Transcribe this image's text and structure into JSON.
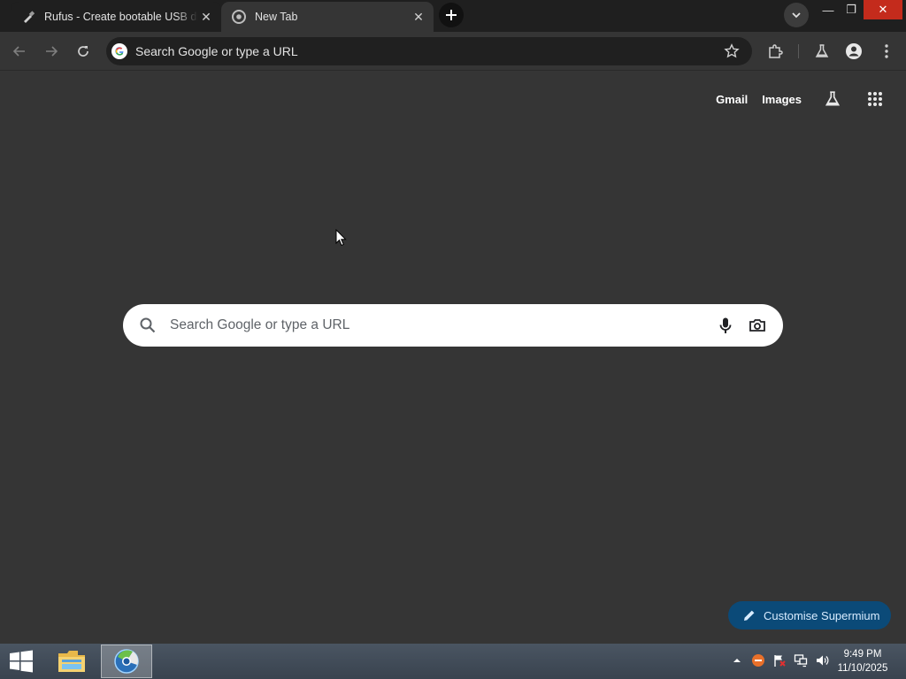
{
  "tabs": [
    {
      "title": "Rufus - Create bootable USB drives the easy way",
      "active": false,
      "favicon": "rufus-usb-icon"
    },
    {
      "title": "New Tab",
      "active": true,
      "favicon": "chrome-icon"
    }
  ],
  "window_controls": {
    "minimize": "—",
    "restore": "❐",
    "close": "✕"
  },
  "omnibox": {
    "placeholder": "Search Google or type a URL"
  },
  "ntp": {
    "links": {
      "gmail": "Gmail",
      "images": "Images"
    },
    "search_placeholder": "Search Google or type a URL",
    "customise_label": "Customise Supermium"
  },
  "taskbar": {
    "clock_time": "9:49 PM",
    "clock_date": "11/10/2025"
  },
  "colors": {
    "accent_blue": "#0b4a78",
    "close_red": "#c42b1c",
    "page_bg": "#353535"
  }
}
